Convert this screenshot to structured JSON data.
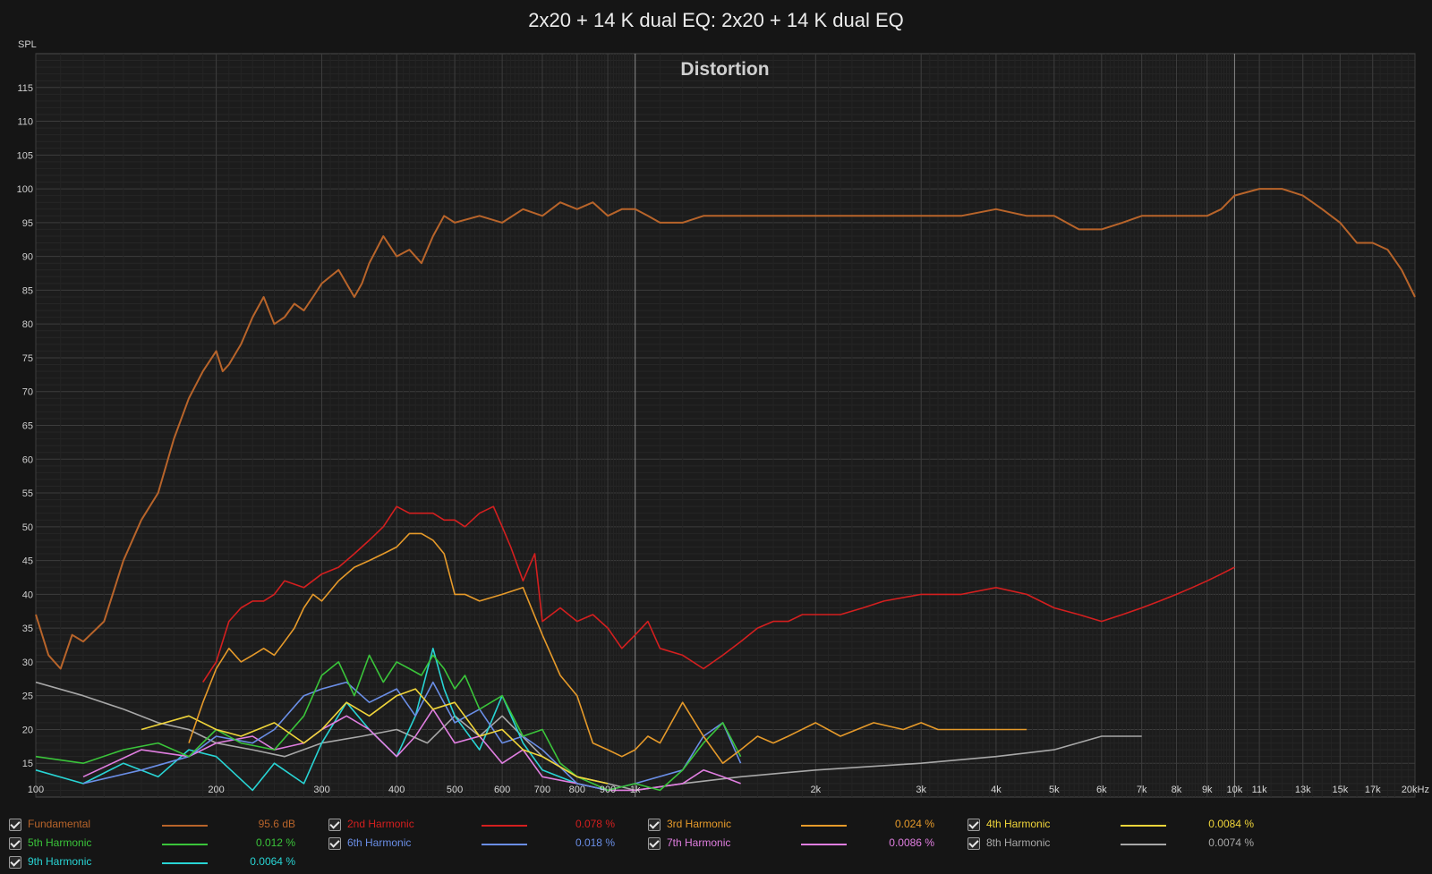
{
  "chart_data": {
    "type": "line",
    "title": "2x20 + 14 K dual EQ: 2x20 + 14 K dual EQ",
    "subtitle": "Distortion",
    "ylabel": "SPL",
    "xscale": "log",
    "xlim": [
      100,
      20000
    ],
    "ylim": [
      10,
      120
    ],
    "x_ticks": [
      {
        "v": 100,
        "label": "100"
      },
      {
        "v": 200,
        "label": "200"
      },
      {
        "v": 300,
        "label": "300"
      },
      {
        "v": 400,
        "label": "400"
      },
      {
        "v": 500,
        "label": "500"
      },
      {
        "v": 600,
        "label": "600"
      },
      {
        "v": 700,
        "label": "700"
      },
      {
        "v": 800,
        "label": "800"
      },
      {
        "v": 900,
        "label": "900"
      },
      {
        "v": 1000,
        "label": "1k"
      },
      {
        "v": 2000,
        "label": "2k"
      },
      {
        "v": 3000,
        "label": "3k"
      },
      {
        "v": 4000,
        "label": "4k"
      },
      {
        "v": 5000,
        "label": "5k"
      },
      {
        "v": 6000,
        "label": "6k"
      },
      {
        "v": 7000,
        "label": "7k"
      },
      {
        "v": 8000,
        "label": "8k"
      },
      {
        "v": 9000,
        "label": "9k"
      },
      {
        "v": 10000,
        "label": "10k"
      },
      {
        "v": 11000,
        "label": "11k"
      },
      {
        "v": 13000,
        "label": "13k"
      },
      {
        "v": 15000,
        "label": "15k"
      },
      {
        "v": 17000,
        "label": "17k"
      },
      {
        "v": 20000,
        "label": "20kHz"
      }
    ],
    "y_ticks": [
      15,
      20,
      25,
      30,
      35,
      40,
      45,
      50,
      55,
      60,
      65,
      70,
      75,
      80,
      85,
      90,
      95,
      100,
      105,
      110,
      115
    ],
    "grid": true,
    "legend_position": "bottom",
    "series": [
      {
        "name": "Fundamental",
        "color": "#b8642a",
        "value": "95.6 dB",
        "x": [
          100,
          105,
          110,
          115,
          120,
          130,
          140,
          150,
          160,
          170,
          180,
          190,
          200,
          205,
          210,
          220,
          230,
          240,
          250,
          260,
          270,
          280,
          290,
          300,
          320,
          340,
          350,
          360,
          380,
          400,
          420,
          440,
          460,
          480,
          500,
          550,
          600,
          650,
          700,
          750,
          800,
          850,
          900,
          950,
          1000,
          1050,
          1100,
          1200,
          1300,
          1400,
          1500,
          1700,
          2000,
          2500,
          3000,
          3500,
          4000,
          4500,
          5000,
          5500,
          6000,
          6500,
          7000,
          7500,
          8000,
          9000,
          9500,
          10000,
          11000,
          12000,
          13000,
          14000,
          15000,
          16000,
          17000,
          18000,
          19000,
          20000
        ],
        "y": [
          37,
          31,
          29,
          34,
          33,
          36,
          45,
          51,
          55,
          63,
          69,
          73,
          76,
          73,
          74,
          77,
          81,
          84,
          80,
          81,
          83,
          82,
          84,
          86,
          88,
          84,
          86,
          89,
          93,
          90,
          91,
          89,
          93,
          96,
          95,
          96,
          95,
          97,
          96,
          98,
          97,
          98,
          96,
          97,
          97,
          96,
          95,
          95,
          96,
          96,
          96,
          96,
          96,
          96,
          96,
          96,
          97,
          96,
          96,
          94,
          94,
          95,
          96,
          96,
          96,
          96,
          97,
          99,
          100,
          100,
          99,
          97,
          95,
          92,
          92,
          91,
          88,
          84
        ]
      },
      {
        "name": "2nd Harmonic",
        "color": "#d41f1f",
        "value": "0.078 %",
        "x": [
          190,
          200,
          210,
          220,
          230,
          240,
          250,
          260,
          280,
          300,
          320,
          340,
          360,
          380,
          400,
          420,
          440,
          460,
          480,
          500,
          520,
          550,
          580,
          600,
          620,
          650,
          680,
          700,
          750,
          800,
          850,
          900,
          950,
          1000,
          1050,
          1100,
          1200,
          1300,
          1400,
          1500,
          1600,
          1700,
          1800,
          1900,
          2000,
          2200,
          2400,
          2600,
          3000,
          3500,
          4000,
          4500,
          5000,
          5500,
          6000,
          6500,
          7000,
          7500,
          8000,
          8500,
          9000,
          9500,
          10000
        ],
        "y": [
          27,
          30,
          36,
          38,
          39,
          39,
          40,
          42,
          41,
          43,
          44,
          46,
          48,
          50,
          53,
          52,
          52,
          52,
          51,
          51,
          50,
          52,
          53,
          50,
          47,
          42,
          46,
          36,
          38,
          36,
          37,
          35,
          32,
          34,
          36,
          32,
          31,
          29,
          31,
          33,
          35,
          36,
          36,
          37,
          37,
          37,
          38,
          39,
          40,
          40,
          41,
          40,
          38,
          37,
          36,
          37,
          38,
          39,
          40,
          41,
          42,
          43,
          44
        ]
      },
      {
        "name": "3rd Harmonic",
        "color": "#e69a2a",
        "value": "0.024 %",
        "x": [
          180,
          190,
          200,
          210,
          220,
          230,
          240,
          250,
          260,
          270,
          280,
          290,
          300,
          320,
          340,
          360,
          380,
          400,
          420,
          440,
          460,
          480,
          500,
          520,
          550,
          600,
          650,
          700,
          750,
          800,
          850,
          900,
          950,
          1000,
          1050,
          1100,
          1200,
          1300,
          1400,
          1500,
          1600,
          1700,
          1800,
          2000,
          2200,
          2500,
          2800,
          3000,
          3200,
          3500,
          4000,
          4500
        ],
        "y": [
          18,
          24,
          29,
          32,
          30,
          31,
          32,
          31,
          33,
          35,
          38,
          40,
          39,
          42,
          44,
          45,
          46,
          47,
          49,
          49,
          48,
          46,
          40,
          40,
          39,
          40,
          41,
          34,
          28,
          25,
          18,
          17,
          16,
          17,
          19,
          18,
          24,
          19,
          15,
          17,
          19,
          18,
          19,
          21,
          19,
          21,
          20,
          21,
          20,
          20,
          20,
          20
        ]
      },
      {
        "name": "4th Harmonic",
        "color": "#f0d53a",
        "value": "0.0084 %",
        "x": [
          150,
          180,
          200,
          220,
          250,
          280,
          300,
          330,
          360,
          400,
          430,
          460,
          500,
          550,
          600,
          650,
          700,
          800,
          900
        ],
        "y": [
          20,
          22,
          20,
          19,
          21,
          18,
          20,
          24,
          22,
          25,
          26,
          23,
          24,
          19,
          20,
          17,
          16,
          13,
          12
        ]
      },
      {
        "name": "5th Harmonic",
        "color": "#3ac43a",
        "value": "0.012 %",
        "x": [
          100,
          120,
          140,
          160,
          180,
          200,
          220,
          250,
          280,
          300,
          320,
          340,
          360,
          380,
          400,
          420,
          440,
          460,
          480,
          500,
          520,
          550,
          600,
          650,
          700,
          750,
          800,
          850,
          900,
          1000,
          1100,
          1200,
          1300,
          1400,
          1500
        ],
        "y": [
          16,
          15,
          17,
          18,
          16,
          20,
          18,
          17,
          22,
          28,
          30,
          25,
          31,
          27,
          30,
          29,
          28,
          31,
          29,
          26,
          28,
          23,
          25,
          19,
          20,
          15,
          13,
          12,
          11,
          12,
          11,
          14,
          18,
          21,
          16
        ]
      },
      {
        "name": "6th Harmonic",
        "color": "#6a8ee6",
        "value": "0.018 %",
        "x": [
          120,
          150,
          180,
          200,
          230,
          250,
          280,
          300,
          330,
          360,
          400,
          430,
          460,
          500,
          550,
          600,
          650,
          700,
          800,
          900,
          1000,
          1200,
          1300,
          1400,
          1500
        ],
        "y": [
          12,
          14,
          16,
          19,
          18,
          20,
          25,
          26,
          27,
          24,
          26,
          22,
          27,
          21,
          23,
          18,
          19,
          17,
          12,
          11,
          12,
          14,
          19,
          21,
          15
        ]
      },
      {
        "name": "7th Harmonic",
        "color": "#e07ee0",
        "value": "0.0086 %",
        "x": [
          120,
          150,
          180,
          200,
          230,
          250,
          280,
          300,
          330,
          360,
          400,
          430,
          460,
          500,
          550,
          600,
          650,
          700,
          800,
          900,
          1000,
          1200,
          1300,
          1400,
          1500
        ],
        "y": [
          13,
          17,
          16,
          18,
          19,
          17,
          18,
          20,
          22,
          20,
          16,
          19,
          23,
          18,
          19,
          15,
          17,
          13,
          12,
          11,
          11,
          12,
          14,
          13,
          12
        ]
      },
      {
        "name": "8th Harmonic",
        "color": "#a8a8a8",
        "value": "0.0074 %",
        "x": [
          100,
          120,
          140,
          160,
          180,
          200,
          230,
          260,
          300,
          350,
          400,
          450,
          500,
          550,
          600,
          700,
          800,
          900,
          1000,
          1200,
          1500,
          2000,
          3000,
          4000,
          5000,
          6000,
          7000
        ],
        "y": [
          27,
          25,
          23,
          21,
          20,
          18,
          17,
          16,
          18,
          19,
          20,
          18,
          22,
          19,
          22,
          16,
          13,
          12,
          11,
          12,
          13,
          14,
          15,
          16,
          17,
          19,
          19
        ]
      },
      {
        "name": "9th Harmonic",
        "color": "#28d4d4",
        "value": "0.0064 %",
        "x": [
          100,
          120,
          140,
          160,
          180,
          200,
          230,
          250,
          280,
          300,
          330,
          360,
          400,
          430,
          460,
          480,
          500,
          550,
          600,
          650,
          700,
          800,
          900
        ],
        "y": [
          14,
          12,
          15,
          13,
          17,
          16,
          11,
          15,
          12,
          18,
          24,
          20,
          16,
          22,
          32,
          26,
          22,
          17,
          25,
          18,
          14,
          12,
          11
        ]
      }
    ]
  }
}
